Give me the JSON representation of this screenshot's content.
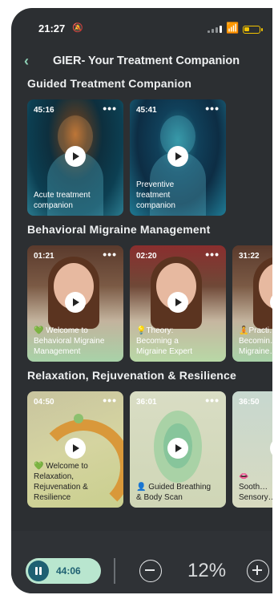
{
  "status_bar": {
    "time": "21:27",
    "bell_icon": "bell-slash-icon",
    "wifi_icon": "wifi-icon",
    "battery_color": "#f2c300"
  },
  "nav": {
    "back_icon": "chevron-left-icon",
    "title": "GIER- Your Treatment Companion"
  },
  "sections": [
    {
      "title": "Guided Treatment  Companion",
      "cards": [
        {
          "duration": "45:16",
          "label": "Acute treatment companion"
        },
        {
          "duration": "45:41",
          "label": "Preventive treatment companion"
        }
      ]
    },
    {
      "title": "Behavioral Migraine  Management",
      "cards": [
        {
          "duration": "01:21",
          "emoji": "💚",
          "label": "Welcome to Behavioral Migraine Management"
        },
        {
          "duration": "02:20",
          "emoji": "💡",
          "label": "Theory: Becoming a Migraine Expert"
        },
        {
          "duration": "31:22",
          "emoji": "🧘",
          "label": "Practi… Becomin… Migraine…"
        }
      ]
    },
    {
      "title": "Relaxation,  Rejuvenation &  Resilience",
      "cards": [
        {
          "duration": "04:50",
          "emoji": "💚",
          "label": "Welcome to Relaxation, Rejuvenation & Resilience"
        },
        {
          "duration": "36:01",
          "emoji": "👤",
          "label": "Guided Breathing & Body Scan"
        },
        {
          "duration": "36:50",
          "emoji": "👄",
          "label": "Sooth… Sensory…"
        }
      ]
    }
  ],
  "player": {
    "time": "44:06",
    "zoom_level": "12%"
  },
  "colors": {
    "background": "#2c2f32",
    "accent": "#8fd1b6",
    "pill": "#b9e6cf",
    "pause": "#1e6072"
  }
}
